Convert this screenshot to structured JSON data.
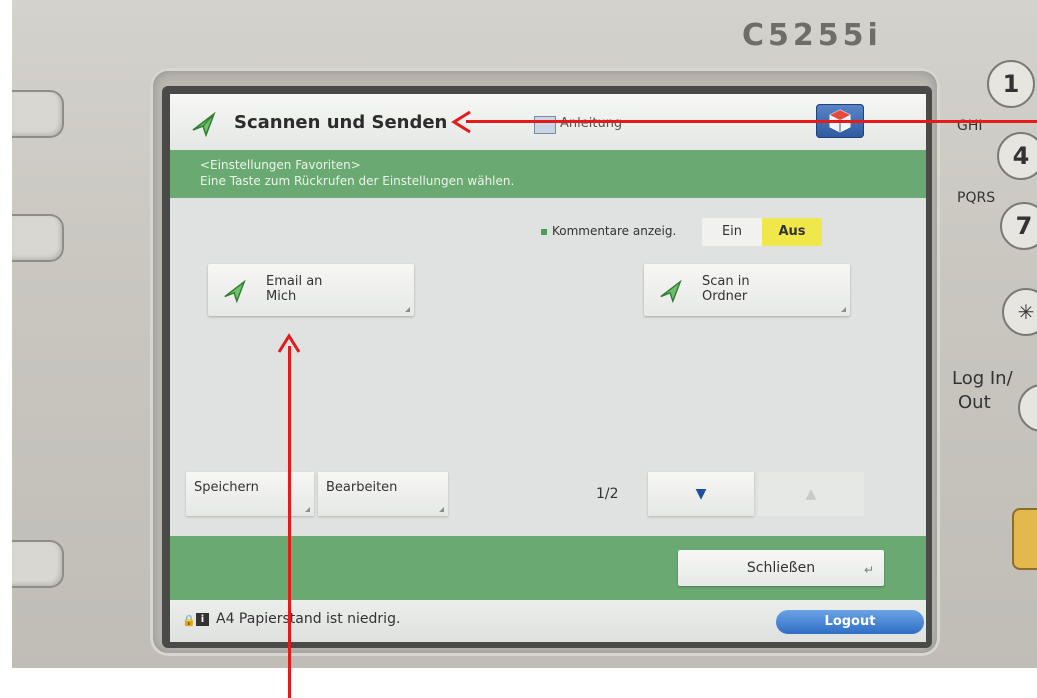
{
  "device": {
    "model": "C5255i",
    "keypad": {
      "key1": "1",
      "key4": "4",
      "key7": "7",
      "key_star": "✳",
      "ghi_label": "GHI",
      "pqrs_label": "PQRS",
      "login_label_line1": "Log In/",
      "login_label_line2": "Out"
    }
  },
  "screen": {
    "title": "Scannen und Senden",
    "guide_label": "Anleitung",
    "info": {
      "line1": "<Einstellungen Favoriten>",
      "line2": "Eine Taste zum Rückrufen der Einstellungen wählen."
    },
    "comments": {
      "label": "Kommentare anzeig.",
      "on_label": "Ein",
      "off_label": "Aus",
      "selected": "Aus"
    },
    "favorites": [
      {
        "label": "Email an\nMich"
      },
      {
        "label": "Scan in\nOrdner"
      }
    ],
    "save_label": "Speichern",
    "edit_label": "Bearbeiten",
    "page_indicator": "1/2",
    "page_down_icon": "▼",
    "page_up_icon": "▲",
    "close_label": "Schließen",
    "status": {
      "icon": "i",
      "text": "A4  Papierstand ist niedrig."
    },
    "logout_label": "Logout"
  },
  "colors": {
    "accent_green": "#6aaa72",
    "toggle_selected": "#f0e84a",
    "logout_blue": "#2f6ec4",
    "annotation_red": "#e31b1b"
  }
}
